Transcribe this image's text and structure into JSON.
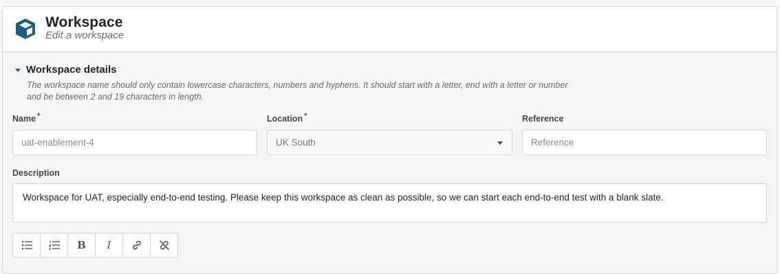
{
  "header": {
    "title": "Workspace",
    "subtitle": "Edit a workspace",
    "icon": "box-icon",
    "icon_color": "#1f5e80"
  },
  "section": {
    "title": "Workspace details",
    "description_line1": "The workspace name should only contain lowercase characters, numbers and hyphens. It should start with a letter, end with a letter or number",
    "description_line2": "and be between 2 and 19 characters in length."
  },
  "fields": {
    "name": {
      "label": "Name",
      "required_mark": "*",
      "placeholder": "uat-enablement-4"
    },
    "location": {
      "label": "Location",
      "required_mark": "*",
      "value": "UK South"
    },
    "reference": {
      "label": "Reference",
      "placeholder": "Reference"
    },
    "description": {
      "label": "Description",
      "value": "Workspace for UAT, especially end-to-end testing. Please keep this workspace as clean as possible, so we can start each end-to-end test with a blank slate."
    }
  },
  "toolbar": {
    "buttons": [
      {
        "name": "bullet-list-icon"
      },
      {
        "name": "numbered-list-icon"
      },
      {
        "name": "bold-icon",
        "label": "B"
      },
      {
        "name": "italic-icon",
        "label": "I"
      },
      {
        "name": "link-icon"
      },
      {
        "name": "unlink-icon"
      }
    ]
  },
  "colors": {
    "accent": "#1b5f8c",
    "background": "#f5f5f3",
    "header_bg": "#ffffff"
  }
}
